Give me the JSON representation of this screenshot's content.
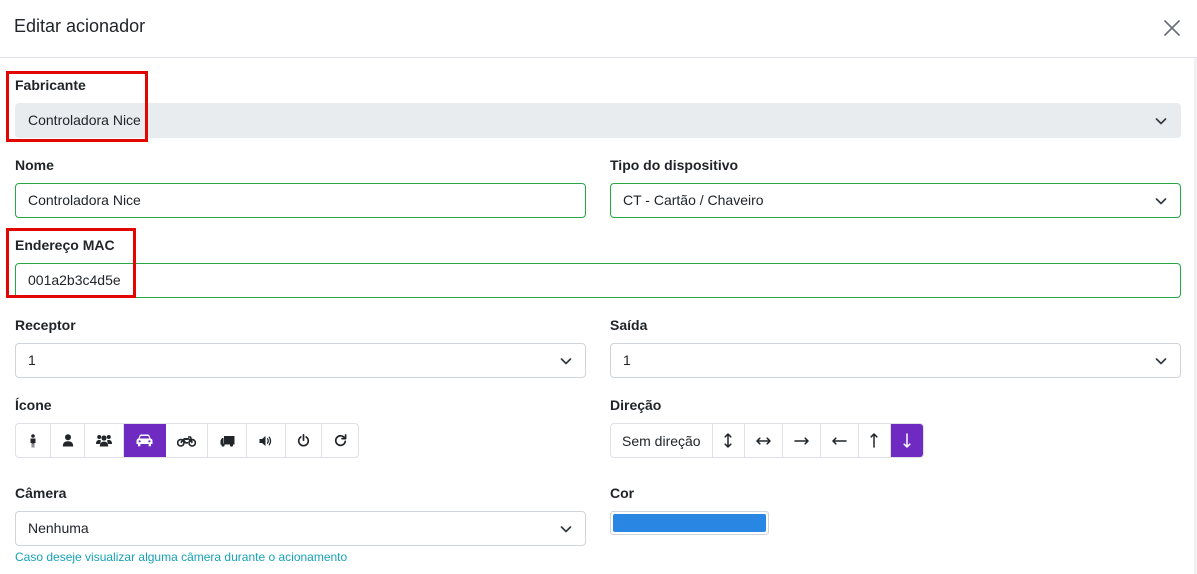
{
  "modal": {
    "title": "Editar acionador",
    "close_icon": "close-icon"
  },
  "form": {
    "fabricante": {
      "label": "Fabricante",
      "value": "Controladora Nice"
    },
    "nome": {
      "label": "Nome",
      "value": "Controladora Nice"
    },
    "tipo": {
      "label": "Tipo do dispositivo",
      "value": "CT - Cartão / Chaveiro"
    },
    "mac": {
      "label": "Endereço MAC",
      "value": "001a2b3c4d5e"
    },
    "receptor": {
      "label": "Receptor",
      "value": "1"
    },
    "saida": {
      "label": "Saída",
      "value": "1"
    },
    "icone": {
      "label": "Ícone",
      "options": [
        "person-icon",
        "user-icon",
        "users-icon",
        "car-icon",
        "motorcycle-icon",
        "truck-icon",
        "volume-icon",
        "power-icon",
        "redo-icon"
      ],
      "selected": "car-icon"
    },
    "direcao": {
      "label": "Direção",
      "none_label": "Sem direção",
      "options": [
        "arrows-vertical-icon",
        "arrows-horizontal-icon",
        "arrow-right-icon",
        "arrow-left-icon",
        "arrow-up-icon",
        "arrow-down-icon"
      ],
      "selected": "arrow-down-icon"
    },
    "camera": {
      "label": "Câmera",
      "value": "Nenhuma",
      "help": "Caso deseje visualizar alguma câmera durante o acionamento"
    },
    "cor": {
      "label": "Cor",
      "value": "#2a86e3"
    }
  },
  "colors": {
    "accent": "#6f2bc1",
    "valid_border": "#28a745",
    "highlight": "#e10600",
    "help_text": "#17a2b8"
  }
}
